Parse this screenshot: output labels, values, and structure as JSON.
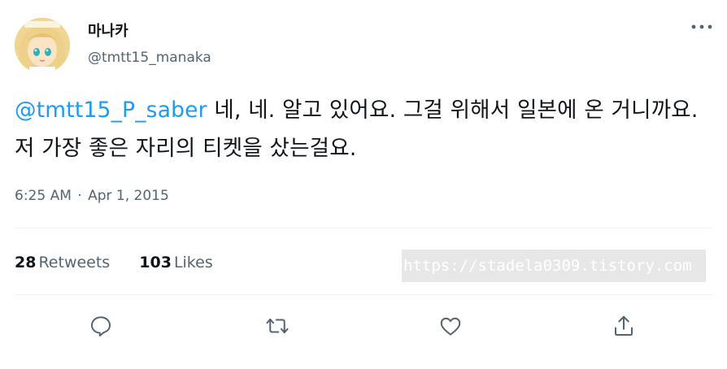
{
  "user": {
    "display_name": "마나카",
    "handle": "@tmtt15_manaka",
    "avatar_icon": "avatar-icon"
  },
  "tweet": {
    "mention": "@tmtt15_P_saber",
    "text": " 네, 네. 알고 있어요. 그걸 위해서 일본에 온 거니까요. 저 가장 좋은 자리의 티켓을 샀는걸요.",
    "time": "6:25 AM",
    "separator": "·",
    "date": "Apr 1, 2015"
  },
  "stats": {
    "retweets_count": "28",
    "retweets_label": "Retweets",
    "likes_count": "103",
    "likes_label": "Likes"
  },
  "watermark": "https://stadela0309.tistory.com",
  "colors": {
    "text": "#0f1419",
    "secondary": "#536471",
    "link": "#1d9bf0",
    "divider": "#eff3f4"
  },
  "actions": [
    "reply-icon",
    "retweet-icon",
    "like-icon",
    "share-icon"
  ]
}
